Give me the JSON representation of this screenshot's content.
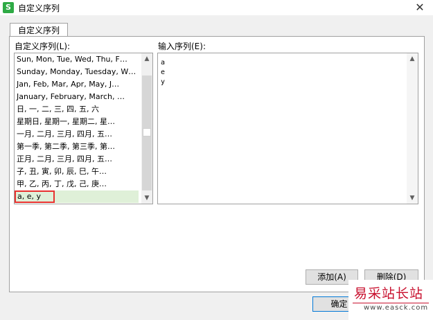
{
  "window": {
    "title": "自定义序列",
    "app_icon": "S",
    "close": "✕"
  },
  "tab": {
    "label": "自定义序列"
  },
  "left_label": "自定义序列(L):",
  "right_label": "输入序列(E):",
  "custom_lists": [
    "Sun, Mon, Tue, Wed, Thu, F…",
    "Sunday, Monday, Tuesday, W…",
    "Jan, Feb, Mar, Apr, May, J…",
    "January, February, March, …",
    "日, 一, 二, 三, 四, 五, 六",
    "星期日, 星期一, 星期二, 星…",
    "一月, 二月, 三月, 四月, 五…",
    "第一季, 第二季, 第三季, 第…",
    "正月, 二月, 三月, 四月, 五…",
    "子, 丑, 寅, 卯, 辰, 巳, 午…",
    "甲, 乙, 丙, 丁, 戊, 己, 庚…",
    "a, e, y"
  ],
  "selected_index": 11,
  "input_sequence": [
    "a",
    "e",
    "y"
  ],
  "buttons": {
    "add": "添加(A)",
    "delete": "删除(D)",
    "ok": "确定"
  },
  "watermark": {
    "brand": "易采站长站",
    "url": "www.easck.com"
  },
  "colors": {
    "selection_bg": "#dff0d8",
    "highlight_border": "#e8312f",
    "app_icon": "#2eaa45"
  }
}
